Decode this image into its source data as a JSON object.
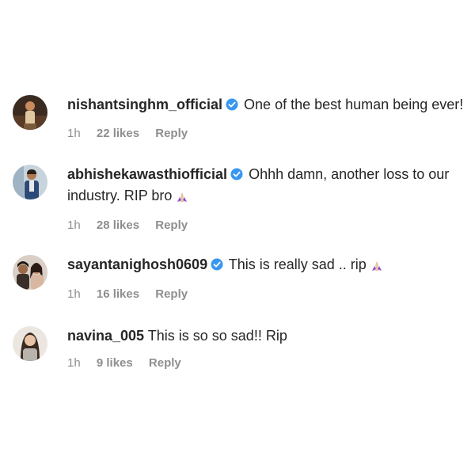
{
  "comments": [
    {
      "username": "nishantsinghm_official",
      "verified": true,
      "text": "One of the best human being ever!",
      "emoji": "",
      "time": "1h",
      "likes": "22 likes",
      "reply": "Reply"
    },
    {
      "username": "abhishekawasthiofficial",
      "verified": true,
      "text": "Ohhh damn, another loss to our industry. RIP bro",
      "emoji": "folded-hands",
      "time": "1h",
      "likes": "28 likes",
      "reply": "Reply"
    },
    {
      "username": "sayantanighosh0609",
      "verified": true,
      "text": "This is really sad .. rip",
      "emoji": "folded-hands",
      "time": "1h",
      "likes": "16 likes",
      "reply": "Reply"
    },
    {
      "username": "navina_005",
      "verified": false,
      "text": "This is so so sad!! Rip",
      "emoji": "",
      "time": "1h",
      "likes": "9 likes",
      "reply": "Reply"
    }
  ],
  "colors": {
    "verified_badge": "#3897f0",
    "meta_text": "#8e8e8e",
    "primary_text": "#262626"
  }
}
